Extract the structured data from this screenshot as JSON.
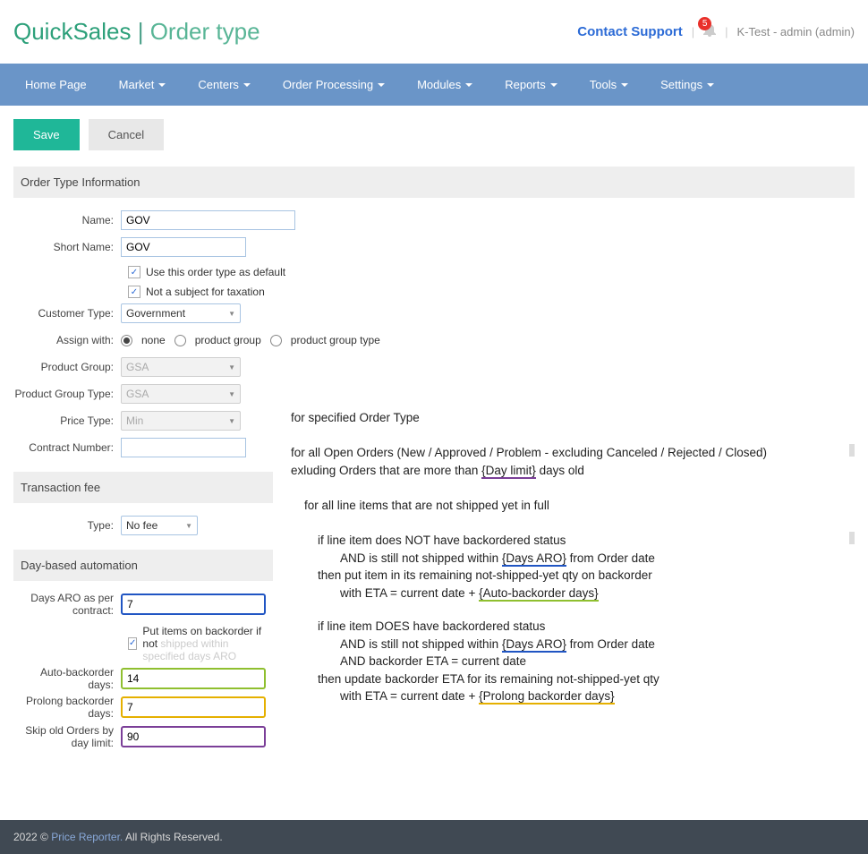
{
  "header": {
    "brand_main": "QuickSales",
    "brand_pipe": " | ",
    "brand_sub": "Order type",
    "contact": "Contact Support",
    "badge_count": "5",
    "user": "K-Test - admin (admin)"
  },
  "nav": [
    {
      "label": "Home Page",
      "has_sub": false
    },
    {
      "label": "Market",
      "has_sub": true
    },
    {
      "label": "Centers",
      "has_sub": true
    },
    {
      "label": "Order Processing",
      "has_sub": true
    },
    {
      "label": "Modules",
      "has_sub": true
    },
    {
      "label": "Reports",
      "has_sub": true
    },
    {
      "label": "Tools",
      "has_sub": true
    },
    {
      "label": "Settings",
      "has_sub": true
    }
  ],
  "buttons": {
    "save": "Save",
    "cancel": "Cancel"
  },
  "sections": {
    "info": "Order Type Information",
    "fee": "Transaction fee",
    "day": "Day-based automation"
  },
  "form": {
    "name_label": "Name:",
    "name_value": "GOV",
    "sname_label": "Short Name:",
    "sname_value": "GOV",
    "cb_default": "Use this order type as default",
    "cb_tax": "Not a subject for taxation",
    "ctype_label": "Customer Type:",
    "ctype_value": "Government",
    "assign_label": "Assign with:",
    "assign_opts": [
      "none",
      "product group",
      "product group type"
    ],
    "pg_label": "Product Group:",
    "pg_value": "GSA",
    "pgt_label": "Product Group Type:",
    "pgt_value": "GSA",
    "price_label": "Price Type:",
    "price_value": "Min",
    "contract_label": "Contract Number:",
    "contract_value": "",
    "fee_type_label": "Type:",
    "fee_type_value": "No fee",
    "days_aro_label": "Days ARO as per contract:",
    "days_aro_value": "7",
    "cb_backorder_pre": "Put items on backorder if not",
    "cb_backorder_faded": " shipped within specified days ARO",
    "auto_back_label": "Auto-backorder days:",
    "auto_back_value": "14",
    "prolong_label": "Prolong backorder days:",
    "prolong_value": "7",
    "skip_label": "Skip old Orders by day limit:",
    "skip_value": "90"
  },
  "rules": {
    "l1": "for specified Order Type",
    "l2_a": "for all Open Orders (New / Approved / Problem - excluding Canceled / Rejected / Closed)",
    "l2_b_pre": "exluding Orders that are more than ",
    "l2_b_link": "{Day limit}",
    "l2_b_post": " days old",
    "l3": "for all line items that are not shipped yet in full",
    "l4": "if line item does NOT have backordered status",
    "l5_pre": "AND is still not shipped within ",
    "l5_link": "{Days ARO}",
    "l5_post": " from Order date",
    "l6": "then put item in its remaining not-shipped-yet qty on backorder",
    "l7_pre": "with ETA = current date + ",
    "l7_link": "{Auto-backorder days}",
    "l8": "if line item DOES have backordered status",
    "l9_pre": "AND is still not shipped within ",
    "l9_link": "{Days ARO}",
    "l9_post": " from Order date",
    "l10": "AND backorder ETA = current date",
    "l11": "then update backorder ETA for its remaining not-shipped-yet qty",
    "l12_pre": "with ETA = current date + ",
    "l12_link": "{Prolong backorder days}"
  },
  "footer": {
    "year": "2022 © ",
    "link": "Price Reporter.",
    "rest": " All Rights Reserved."
  }
}
